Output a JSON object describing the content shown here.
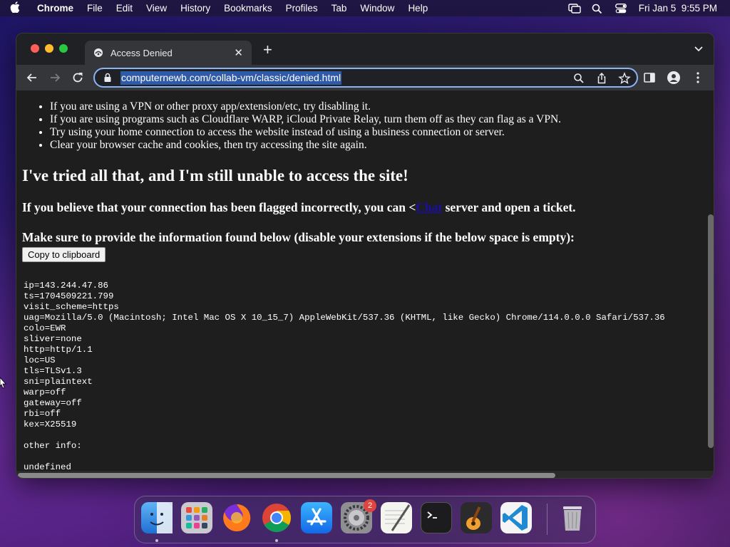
{
  "menubar": {
    "app_name": "Chrome",
    "items": [
      "File",
      "Edit",
      "View",
      "History",
      "Bookmarks",
      "Profiles",
      "Tab",
      "Window",
      "Help"
    ],
    "clock": "Fri Jan 5  9:55 PM"
  },
  "browser": {
    "tab_title": "Access Denied",
    "url": "computernewb.com/collab-vm/classic/denied.html"
  },
  "page": {
    "bullets": [
      "If you are using a VPN or other proxy app/extension/etc, try disabling it.",
      "If you are using programs such as Cloudflare WARP, iCloud Private Relay, turn them off as they can flag as a VPN.",
      "Try using your home connection to access the website instead of using a business connection or server.",
      "Clear your browser cache and cookies, then try accessing the site again."
    ],
    "heading": "I've tried all that, and I'm still unable to access the site!",
    "flagged_prefix": "If you believe that your connection has been flagged incorrectly, you can <",
    "flagged_link": "Chat",
    "flagged_suffix": " server and open a ticket.",
    "instructions": "Make sure to provide the information found below (disable your extensions if the below space is empty):",
    "copy_button": "Copy to clipboard",
    "trace_lines": [
      "ip=143.244.47.86",
      "ts=1704509221.799",
      "visit_scheme=https",
      "uag=Mozilla/5.0 (Macintosh; Intel Mac OS X 10_15_7) AppleWebKit/537.36 (KHTML, like Gecko) Chrome/114.0.0.0 Safari/537.36",
      "colo=EWR",
      "sliver=none",
      "http=http/1.1",
      "loc=US",
      "tls=TLSv1.3",
      "sni=plaintext",
      "warp=off",
      "gateway=off",
      "rbi=off",
      "kex=X25519",
      "",
      "other info:",
      "",
      "undefined"
    ]
  },
  "dock": {
    "apps": [
      "finder-icon",
      "launchpad-icon",
      "firefox-icon",
      "chrome-icon",
      "app-store-icon",
      "system-settings-icon",
      "textedit-icon",
      "terminal-icon",
      "garageband-icon",
      "vscode-icon",
      "trash-icon"
    ],
    "settings_badge": "2"
  }
}
